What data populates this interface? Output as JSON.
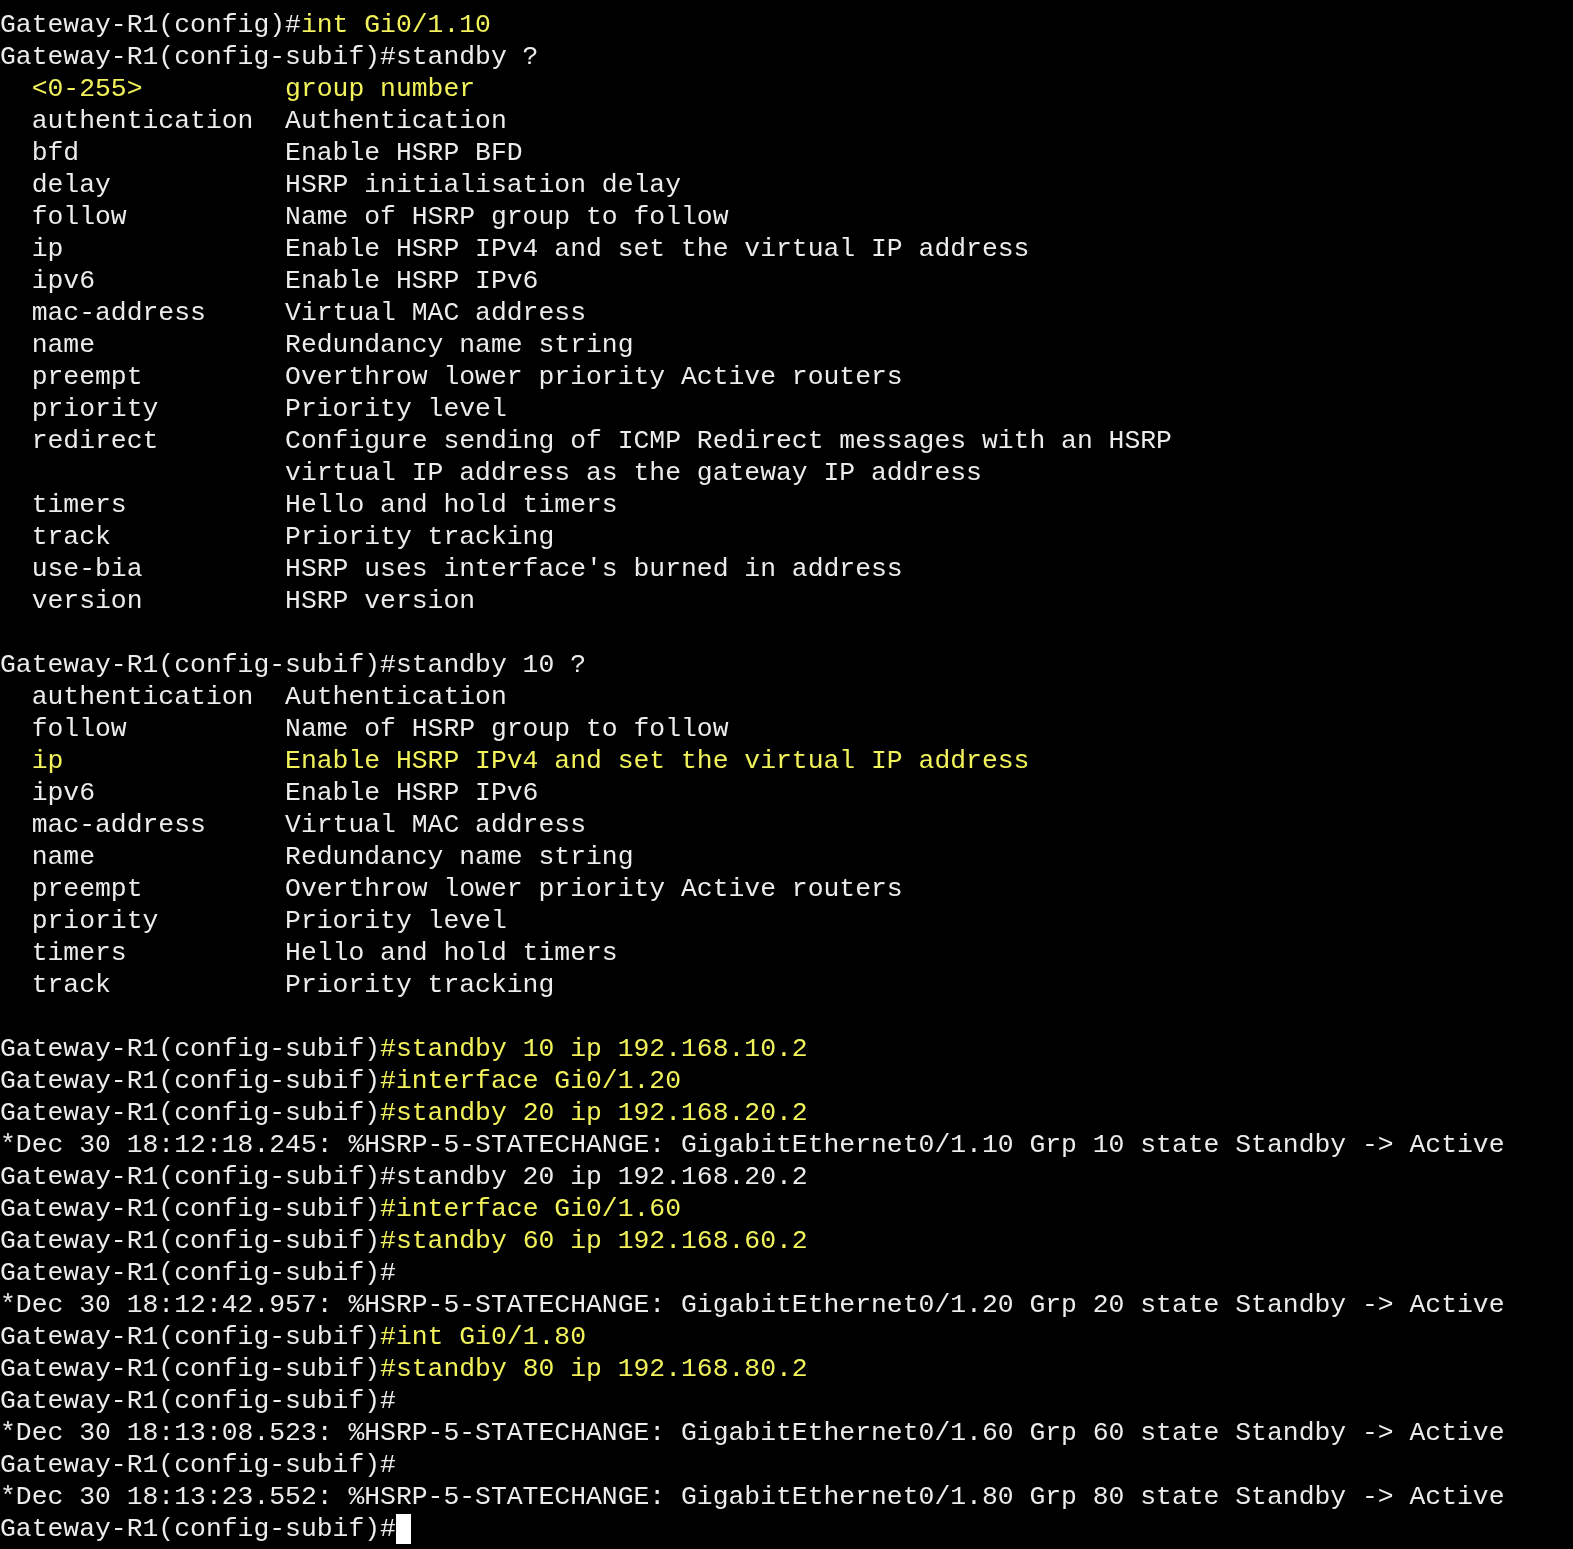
{
  "lines": [
    {
      "kind": "text",
      "segments": [
        {
          "text": "Gateway-R1(config)#",
          "highlighted": false
        },
        {
          "text": "int Gi0/1.10",
          "highlighted": true
        }
      ]
    },
    {
      "kind": "text",
      "segments": [
        {
          "text": "Gateway-R1(config-subif)#standby ?",
          "highlighted": false
        }
      ]
    },
    {
      "kind": "help",
      "keyword": "<0-255>",
      "description": "group number",
      "highlighted": true
    },
    {
      "kind": "help",
      "keyword": "authentication",
      "description": "Authentication",
      "highlighted": false
    },
    {
      "kind": "help",
      "keyword": "bfd",
      "description": "Enable HSRP BFD",
      "highlighted": false
    },
    {
      "kind": "help",
      "keyword": "delay",
      "description": "HSRP initialisation delay",
      "highlighted": false
    },
    {
      "kind": "help",
      "keyword": "follow",
      "description": "Name of HSRP group to follow",
      "highlighted": false
    },
    {
      "kind": "help",
      "keyword": "ip",
      "description": "Enable HSRP IPv4 and set the virtual IP address",
      "highlighted": false
    },
    {
      "kind": "help",
      "keyword": "ipv6",
      "description": "Enable HSRP IPv6",
      "highlighted": false
    },
    {
      "kind": "help",
      "keyword": "mac-address",
      "description": "Virtual MAC address",
      "highlighted": false
    },
    {
      "kind": "help",
      "keyword": "name",
      "description": "Redundancy name string",
      "highlighted": false
    },
    {
      "kind": "help",
      "keyword": "preempt",
      "description": "Overthrow lower priority Active routers",
      "highlighted": false
    },
    {
      "kind": "help",
      "keyword": "priority",
      "description": "Priority level",
      "highlighted": false
    },
    {
      "kind": "help",
      "keyword": "redirect",
      "description": "Configure sending of ICMP Redirect messages with an HSRP",
      "highlighted": false
    },
    {
      "kind": "help",
      "description": "virtual IP address as the gateway IP address",
      "highlighted": false
    },
    {
      "kind": "help",
      "keyword": "timers",
      "description": "Hello and hold timers",
      "highlighted": false
    },
    {
      "kind": "help",
      "keyword": "track",
      "description": "Priority tracking",
      "highlighted": false
    },
    {
      "kind": "help",
      "keyword": "use-bia",
      "description": "HSRP uses interface's burned in address",
      "highlighted": false
    },
    {
      "kind": "help",
      "keyword": "version",
      "description": "HSRP version",
      "highlighted": false
    },
    {
      "kind": "blank"
    },
    {
      "kind": "text",
      "segments": [
        {
          "text": "Gateway-R1(config-subif)#standby 10 ?",
          "highlighted": false
        }
      ]
    },
    {
      "kind": "help",
      "keyword": "authentication",
      "description": "Authentication",
      "highlighted": false
    },
    {
      "kind": "help",
      "keyword": "follow",
      "description": "Name of HSRP group to follow",
      "highlighted": false
    },
    {
      "kind": "help",
      "keyword": "ip",
      "description": "Enable HSRP IPv4 and set the virtual IP address",
      "highlighted": true
    },
    {
      "kind": "help",
      "keyword": "ipv6",
      "description": "Enable HSRP IPv6",
      "highlighted": false
    },
    {
      "kind": "help",
      "keyword": "mac-address",
      "description": "Virtual MAC address",
      "highlighted": false
    },
    {
      "kind": "help",
      "keyword": "name",
      "description": "Redundancy name string",
      "highlighted": false
    },
    {
      "kind": "help",
      "keyword": "preempt",
      "description": "Overthrow lower priority Active routers",
      "highlighted": false
    },
    {
      "kind": "help",
      "keyword": "priority",
      "description": "Priority level",
      "highlighted": false
    },
    {
      "kind": "help",
      "keyword": "timers",
      "description": "Hello and hold timers",
      "highlighted": false
    },
    {
      "kind": "help",
      "keyword": "track",
      "description": "Priority tracking",
      "highlighted": false
    },
    {
      "kind": "blank"
    },
    {
      "kind": "text",
      "segments": [
        {
          "text": "Gateway-R1(config-subif)",
          "highlighted": false
        },
        {
          "text": "#standby 10 ip 192.168.10.2",
          "highlighted": true
        }
      ]
    },
    {
      "kind": "text",
      "segments": [
        {
          "text": "Gateway-R1(config-subif)",
          "highlighted": false
        },
        {
          "text": "#interface Gi0/1.20",
          "highlighted": true
        }
      ]
    },
    {
      "kind": "text",
      "segments": [
        {
          "text": "Gateway-R1(config-subif)",
          "highlighted": false
        },
        {
          "text": "#standby 20 ip 192.168.20.2",
          "highlighted": true
        }
      ]
    },
    {
      "kind": "text",
      "segments": [
        {
          "text": "*Dec 30 18:12:18.245: %HSRP-5-STATECHANGE: GigabitEthernet0/1.10 Grp 10 state Standby -> Active",
          "highlighted": false
        }
      ]
    },
    {
      "kind": "text",
      "segments": [
        {
          "text": "Gateway-R1(config-subif)#standby 20 ip 192.168.20.2",
          "highlighted": false
        }
      ]
    },
    {
      "kind": "text",
      "segments": [
        {
          "text": "Gateway-R1(config-subif)",
          "highlighted": false
        },
        {
          "text": "#interface Gi0/1.60",
          "highlighted": true
        }
      ]
    },
    {
      "kind": "text",
      "segments": [
        {
          "text": "Gateway-R1(config-subif)",
          "highlighted": false
        },
        {
          "text": "#standby 60 ip 192.168.60.2",
          "highlighted": true
        }
      ]
    },
    {
      "kind": "text",
      "segments": [
        {
          "text": "Gateway-R1(config-subif)#",
          "highlighted": false
        }
      ]
    },
    {
      "kind": "text",
      "segments": [
        {
          "text": "*Dec 30 18:12:42.957: %HSRP-5-STATECHANGE: GigabitEthernet0/1.20 Grp 20 state Standby -> Active",
          "highlighted": false
        }
      ]
    },
    {
      "kind": "text",
      "segments": [
        {
          "text": "Gateway-R1(config-subif)",
          "highlighted": false
        },
        {
          "text": "#int Gi0/1.80",
          "highlighted": true
        }
      ]
    },
    {
      "kind": "text",
      "segments": [
        {
          "text": "Gateway-R1(config-subif)",
          "highlighted": false
        },
        {
          "text": "#standby 80 ip 192.168.80.2",
          "highlighted": true
        }
      ]
    },
    {
      "kind": "text",
      "segments": [
        {
          "text": "Gateway-R1(config-subif)#",
          "highlighted": false
        }
      ]
    },
    {
      "kind": "text",
      "segments": [
        {
          "text": "*Dec 30 18:13:08.523: %HSRP-5-STATECHANGE: GigabitEthernet0/1.60 Grp 60 state Standby -> Active",
          "highlighted": false
        }
      ]
    },
    {
      "kind": "text",
      "segments": [
        {
          "text": "Gateway-R1(config-subif)#",
          "highlighted": false
        }
      ]
    },
    {
      "kind": "text",
      "segments": [
        {
          "text": "*Dec 30 18:13:23.552: %HSRP-5-STATECHANGE: GigabitEthernet0/1.80 Grp 80 state Standby -> Active",
          "highlighted": false
        }
      ]
    },
    {
      "kind": "text",
      "segments": [
        {
          "text": "Gateway-R1(config-subif)#",
          "highlighted": false
        }
      ],
      "cursor": true
    }
  ]
}
